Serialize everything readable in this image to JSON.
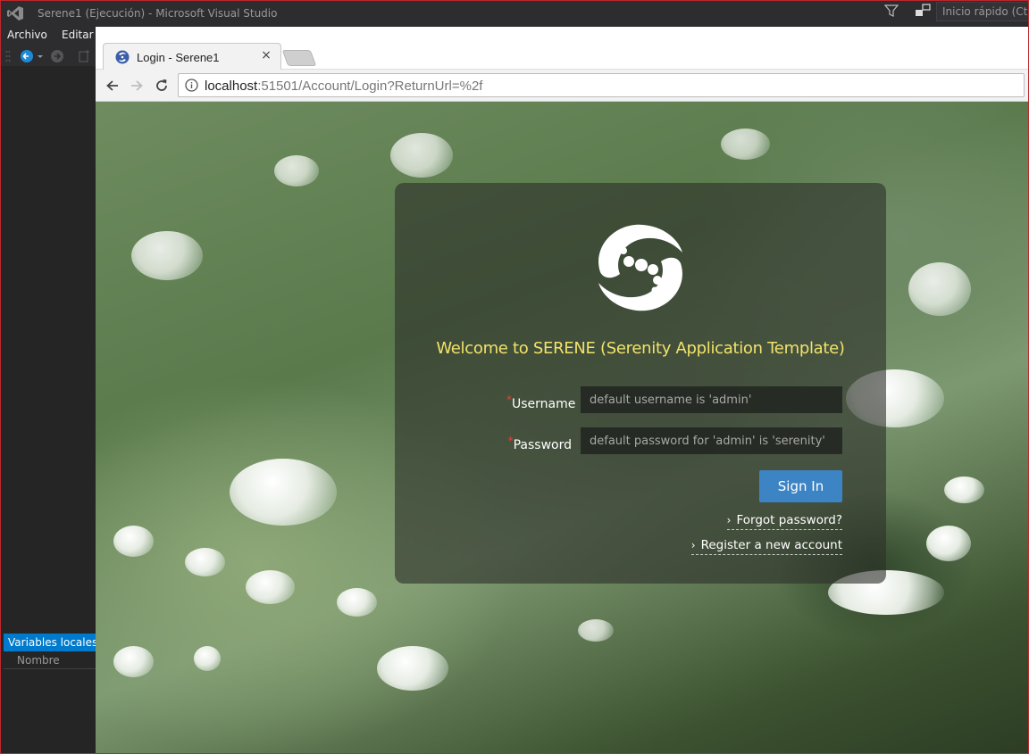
{
  "vs": {
    "title": "Serene1 (Ejecución) - Microsoft Visual Studio",
    "quick_launch": "Inicio rápido (Ctrl+Q)",
    "menu": [
      "Archivo",
      "Editar"
    ],
    "locals_tab": "Variables locales",
    "locals_column": "Nombre",
    "accent_color": "#007acc"
  },
  "browser": {
    "tab_title": "Login - Serene1",
    "tab_close": "×",
    "url_host": "localhost",
    "url_path": ":51501/Account/Login?ReturnUrl=%2f"
  },
  "login": {
    "welcome": "Welcome to SERENE (Serenity Application Template)",
    "required_mark": "*",
    "username_label": "Username",
    "username_placeholder": "default username is 'admin'",
    "password_label": "Password",
    "password_placeholder": "default password for 'admin' is 'serenity'",
    "signin_label": "Sign In",
    "forgot_label": "Forgot password?",
    "register_label": "Register a new account",
    "chevron": "›",
    "welcome_color": "#f2e26a",
    "button_color": "#3c84c4"
  }
}
